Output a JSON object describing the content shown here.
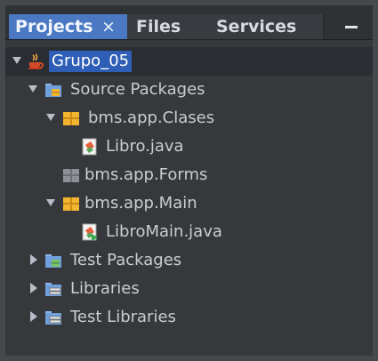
{
  "tabs": {
    "projects": "Projects",
    "close_glyph": "×",
    "files": "Files",
    "services": "Services"
  },
  "tree": {
    "root": "Grupo_05",
    "source_packages": "Source Packages",
    "pkg_clases": "bms.app.Clases",
    "file_libro": "Libro.java",
    "pkg_forms": "bms.app.Forms",
    "pkg_main": "bms.app.Main",
    "file_libromain": "LibroMain.java",
    "test_packages": "Test Packages",
    "libraries": "Libraries",
    "test_libraries": "Test Libraries"
  },
  "colors": {
    "selection": "#2e5eb6",
    "active_tab": "#4a78c2",
    "package_yellow": "#f2b531"
  }
}
